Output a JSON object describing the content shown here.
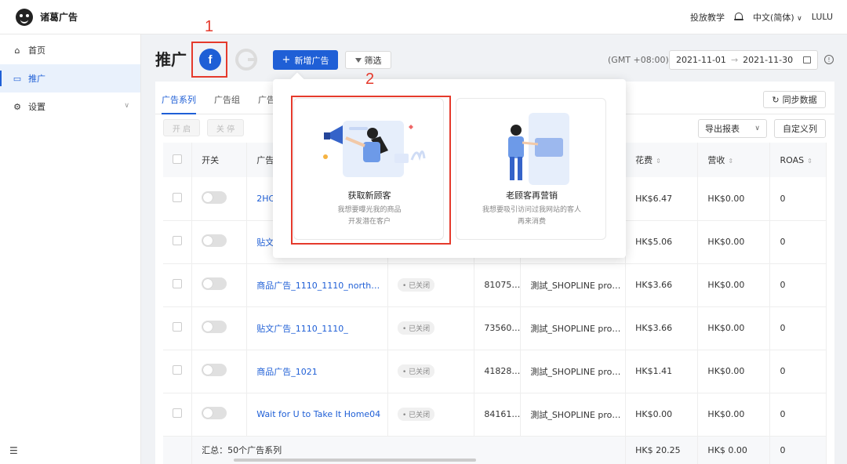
{
  "app": {
    "title": "诸葛广告"
  },
  "topbar": {
    "tutorial": "投放教学",
    "language": "中文(简体)",
    "language_chev": "∨",
    "user": "LULU"
  },
  "sidebar": {
    "items": [
      {
        "label": "首页",
        "icon": "home-icon"
      },
      {
        "label": "推广",
        "icon": "promotion-icon"
      },
      {
        "label": "设置",
        "icon": "settings-icon"
      }
    ],
    "chevron": "∨",
    "collapse_glyph": "☰"
  },
  "header": {
    "title": "推广",
    "fb_glyph": "f",
    "new_ad": "新增广告",
    "new_ad_plus": "+",
    "filter": "筛选",
    "timezone": "(GMT +08:00)",
    "date_start": "2021-11-01",
    "date_arrow": "→",
    "date_end": "2021-11-30",
    "info_glyph": "!"
  },
  "annotations": {
    "one": "1",
    "two": "2"
  },
  "tabs": [
    "广告系列",
    "广告组",
    "广告"
  ],
  "toolbar": {
    "sync": "同步数据",
    "sync_glyph": "↻",
    "enable": "开 启",
    "disable": "关 停",
    "export": "导出报表",
    "export_chev": "∨",
    "custom_columns": "自定义列"
  },
  "table": {
    "headers": {
      "switch": "开关",
      "name": "广告",
      "spend": "花费",
      "revenue": "营收",
      "roas": "ROAS",
      "sort_glyph": "⇕"
    },
    "rows": [
      {
        "name": "2HC",
        "status": "",
        "id": "",
        "account": "",
        "spend": "HK$6.47",
        "revenue": "HK$0.00",
        "roas": "0"
      },
      {
        "name": "贴文",
        "status": "",
        "id": "",
        "account": "",
        "spend": "HK$5.06",
        "revenue": "HK$0.00",
        "roas": "0"
      },
      {
        "name": "商品广告_1110_1110_north…",
        "status": "• 已关闭",
        "id": "81075…",
        "account": "測試_SHOPLINE pro…",
        "spend": "HK$3.66",
        "revenue": "HK$0.00",
        "roas": "0"
      },
      {
        "name": "贴文广告_1110_1110_",
        "status": "• 已关闭",
        "id": "73560…",
        "account": "測試_SHOPLINE pro…",
        "spend": "HK$3.66",
        "revenue": "HK$0.00",
        "roas": "0"
      },
      {
        "name": "商品广告_1021",
        "status": "• 已关闭",
        "id": "41828…",
        "account": "測試_SHOPLINE pro…",
        "spend": "HK$1.41",
        "revenue": "HK$0.00",
        "roas": "0"
      },
      {
        "name": "Wait for U to Take It Home04",
        "status": "• 已关闭",
        "id": "84161…",
        "account": "測試_SHOPLINE pro…",
        "spend": "HK$0.00",
        "revenue": "HK$0.00",
        "roas": "0"
      }
    ],
    "summary": {
      "label": "汇总：50个广告系列",
      "spend": "HK$ 20.25",
      "revenue": "HK$ 0.00",
      "roas": "0"
    }
  },
  "popup": {
    "options": [
      {
        "title": "获取新顾客",
        "line1": "我想要曝光我的商品",
        "line2": "开发潜在客户"
      },
      {
        "title": "老顾客再营销",
        "line1": "我想要吸引访问过我网站的客人",
        "line2": "再来消费"
      }
    ]
  },
  "colors": {
    "accent": "#1f5fd6",
    "annotation": "#e53a2c"
  }
}
